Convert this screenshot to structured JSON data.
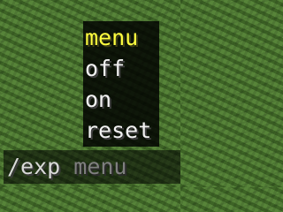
{
  "suggestions": {
    "items": [
      {
        "label": "menu",
        "selected": true
      },
      {
        "label": "off",
        "selected": false
      },
      {
        "label": "on",
        "selected": false
      },
      {
        "label": "reset",
        "selected": false
      }
    ]
  },
  "chat": {
    "typed": "/exp ",
    "suggestion": "menu"
  },
  "colors": {
    "selected_text": "#ffff3f",
    "item_text": "#f2f2f2",
    "suggestion_ghost": "#7f7f7f",
    "grass": "#4f7a33"
  }
}
